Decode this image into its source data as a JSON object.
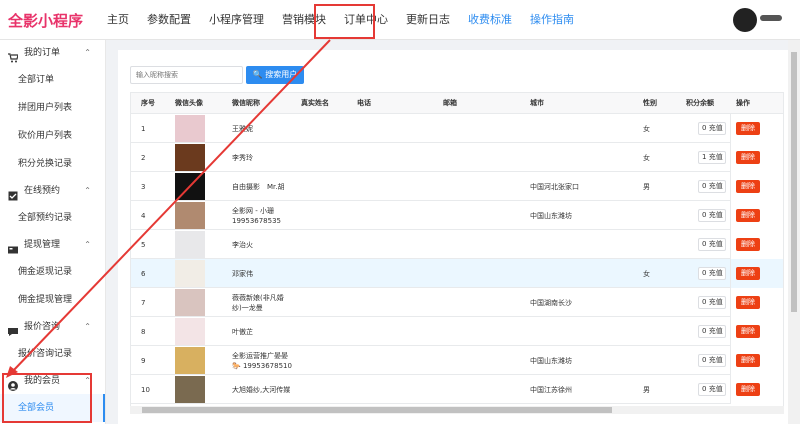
{
  "app": {
    "logo": "全影小程序"
  },
  "nav": [
    {
      "label": "主页",
      "style": "normal"
    },
    {
      "label": "参数配置",
      "style": "normal"
    },
    {
      "label": "小程序管理",
      "style": "normal"
    },
    {
      "label": "营销模块",
      "style": "normal"
    },
    {
      "label": "订单中心",
      "style": "active"
    },
    {
      "label": "更新日志",
      "style": "normal"
    },
    {
      "label": "收费标准",
      "style": "blue"
    },
    {
      "label": "操作指南",
      "style": "blue"
    }
  ],
  "sidebar": {
    "groups": [
      {
        "label": "我的订单",
        "icon": "cart-icon",
        "items": [
          "全部订单",
          "拼团用户列表",
          "砍价用户列表",
          "积分兑换记录"
        ]
      },
      {
        "label": "在线预约",
        "icon": "checkbox-icon",
        "items": [
          "全部预约记录"
        ]
      },
      {
        "label": "提现管理",
        "icon": "card-icon",
        "items": [
          "佣金返现记录",
          "佣金提现管理"
        ]
      },
      {
        "label": "报价咨询",
        "icon": "chat-icon",
        "items": [
          "报价咨询记录"
        ]
      },
      {
        "label": "我的会员",
        "icon": "user-icon",
        "items": [
          "全部会员"
        ]
      }
    ],
    "active_item": "全部会员"
  },
  "search": {
    "placeholder": "输入昵称搜索",
    "button_label": "搜索用户"
  },
  "table": {
    "columns": [
      "序号",
      "微信头像",
      "微信昵称",
      "真实姓名",
      "电话",
      "邮箱",
      "城市",
      "性别",
      "积分余额",
      "操作"
    ],
    "delete_label": "删除",
    "points_suffix": "充值",
    "rows": [
      {
        "no": "1",
        "nickname": "王雅妮",
        "city": "",
        "gender": "女",
        "points": "0",
        "thumb": "#e9c9cf"
      },
      {
        "no": "2",
        "nickname": "李秀玲",
        "city": "",
        "gender": "女",
        "points": "1",
        "thumb": "#6b3a1e"
      },
      {
        "no": "3",
        "nickname": "自由摄影　Mr.胡",
        "city": "中国河北张家口",
        "gender": "男",
        "points": "0",
        "thumb": "#111111"
      },
      {
        "no": "4",
        "nickname": "全影网 - 小珊19953678535",
        "city": "中国山东潍坊",
        "gender": "",
        "points": "0",
        "thumb": "#b08a70"
      },
      {
        "no": "5",
        "nickname": "李治火",
        "city": "",
        "gender": "",
        "points": "0",
        "thumb": "#e8e8ea"
      },
      {
        "no": "6",
        "nickname": "邓家伟",
        "city": "",
        "gender": "女",
        "points": "0",
        "thumb": "#f1ede6"
      },
      {
        "no": "7",
        "nickname": "薇薇新娘(非凡婚纱)一龙曼",
        "city": "中国湖南长沙",
        "gender": "",
        "points": "0",
        "thumb": "#d9c4bf"
      },
      {
        "no": "8",
        "nickname": "叶傲芷",
        "city": "",
        "gender": "",
        "points": "0",
        "thumb": "#f3e4e6"
      },
      {
        "no": "9",
        "nickname": "全影运营推广晏晏🐎 19953678510",
        "city": "中国山东潍坊",
        "gender": "",
        "points": "0",
        "thumb": "#d8b060"
      },
      {
        "no": "10",
        "nickname": "大旭婚纱,大河传媒",
        "city": "中国江苏徐州",
        "gender": "男",
        "points": "0",
        "thumb": "#7a6a50"
      }
    ]
  },
  "colors": {
    "primary": "#2d8cf0",
    "danger": "#ed4014",
    "annotation": "#e53935",
    "brand": "#e8336a"
  }
}
